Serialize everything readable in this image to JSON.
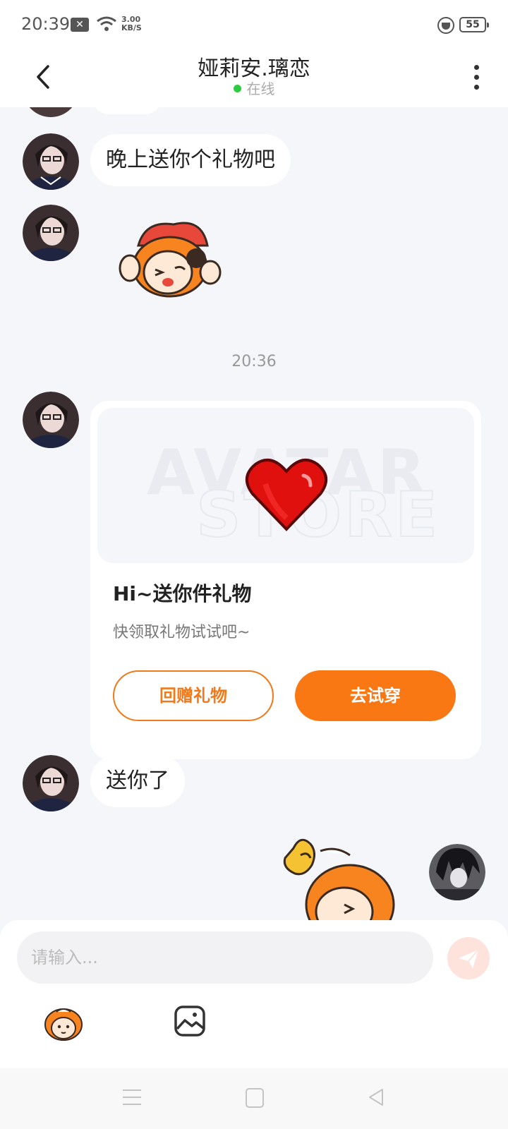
{
  "status_bar": {
    "time": "20:39",
    "notification_icon": "x-badge-icon",
    "net_speed_value": "3.00",
    "net_speed_unit": "KB/S",
    "battery": "55"
  },
  "header": {
    "title": "娅莉安.璃恋",
    "status": "在线",
    "online_color": "#2ecc40"
  },
  "messages": [
    {
      "id": 1,
      "side": "left",
      "type": "text",
      "text": "晚上送你个礼物吧"
    },
    {
      "id": 2,
      "side": "left",
      "type": "sticker",
      "sticker": "hat-character-blowing-kiss-sticker"
    },
    {
      "id": 3,
      "type": "timestamp",
      "text": "20:36"
    },
    {
      "id": 4,
      "side": "left",
      "type": "gift_card",
      "banner_watermark_line1": "AVATAR",
      "banner_watermark_line2": "STORE",
      "gift_icon": "red-heart-icon",
      "title": "Hi~送你件礼物",
      "description": "快领取礼物试试吧~",
      "secondary_button": "回赠礼物",
      "primary_button": "去试穿"
    },
    {
      "id": 5,
      "side": "left",
      "type": "text",
      "text": "送你了"
    },
    {
      "id": 6,
      "side": "right",
      "type": "sticker",
      "sticker": "character-finger-heart-sticker"
    }
  ],
  "composer": {
    "placeholder": "请输入...",
    "send_icon": "paper-plane-icon",
    "tools": [
      "emoji-sticker-icon",
      "image-icon"
    ]
  },
  "colors": {
    "accent": "#fa7814",
    "background": "#f4f6f9",
    "bubble": "#ffffff"
  }
}
